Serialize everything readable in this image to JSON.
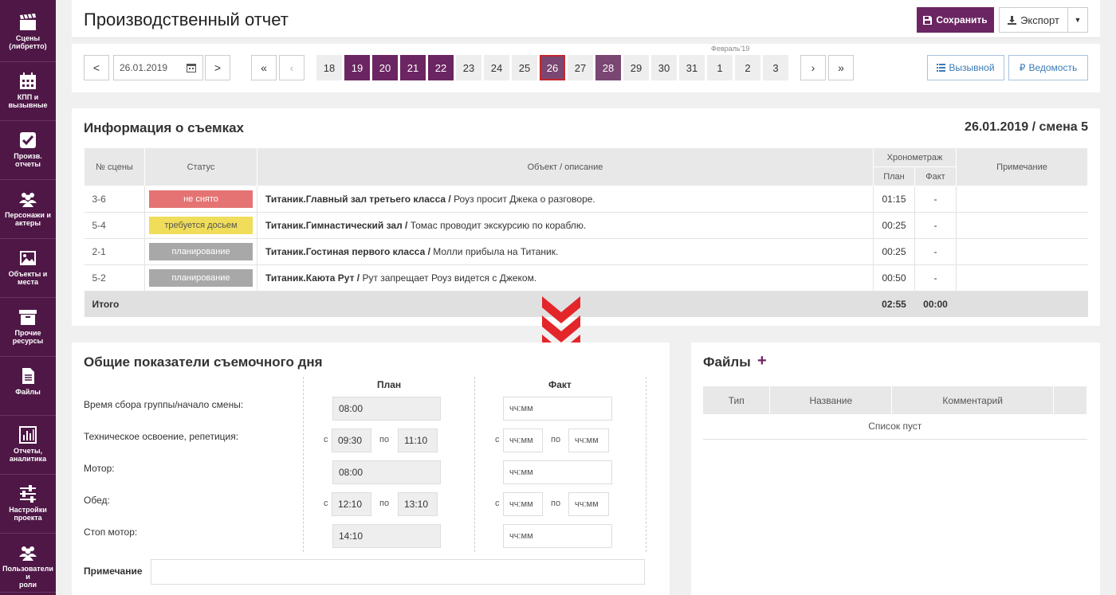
{
  "sidebar": {
    "items": [
      {
        "label": "Сцены\n(либретто)",
        "icon": "clapperboard-icon"
      },
      {
        "label": "КПП и\nвызывные",
        "icon": "calendar-icon"
      },
      {
        "label": "Произв.\nотчеты",
        "icon": "checkbox-icon"
      },
      {
        "label": "Персонажи и\nактеры",
        "icon": "people-icon"
      },
      {
        "label": "Объекты и\nместа",
        "icon": "image-icon"
      },
      {
        "label": "Прочие\nресурсы",
        "icon": "archive-icon"
      },
      {
        "label": "Файлы",
        "icon": "file-icon"
      },
      {
        "label": "Отчеты,\nаналитика",
        "icon": "bar-chart-icon"
      },
      {
        "label": "Настройки\nпроекта",
        "icon": "sliders-icon"
      },
      {
        "label": "Пользователи и\nроли",
        "icon": "users-icon"
      }
    ]
  },
  "header": {
    "title": "Производственный отчет",
    "save_label": "Сохранить",
    "export_label": "Экспорт"
  },
  "datenav": {
    "prev": "<",
    "next": ">",
    "date_value": "26.01.2019",
    "first": "«",
    "prev_page": "‹",
    "next_page": "›",
    "last": "»",
    "month_label": "Февраль'19",
    "days": [
      {
        "label": "18",
        "state": "plain"
      },
      {
        "label": "19",
        "state": "done"
      },
      {
        "label": "20",
        "state": "done"
      },
      {
        "label": "21",
        "state": "done"
      },
      {
        "label": "22",
        "state": "done"
      },
      {
        "label": "23",
        "state": "plain"
      },
      {
        "label": "24",
        "state": "plain"
      },
      {
        "label": "25",
        "state": "plain"
      },
      {
        "label": "26",
        "state": "sel"
      },
      {
        "label": "27",
        "state": "plain"
      },
      {
        "label": "28",
        "state": "light"
      },
      {
        "label": "29",
        "state": "plain"
      },
      {
        "label": "30",
        "state": "plain"
      },
      {
        "label": "31",
        "state": "plain"
      },
      {
        "label": "1",
        "state": "plain"
      },
      {
        "label": "2",
        "state": "plain"
      },
      {
        "label": "3",
        "state": "plain"
      }
    ],
    "callsheet_label": "Вызывной",
    "statement_label": "Ведомость"
  },
  "shooting": {
    "title": "Информация о съемках",
    "date_shift": "26.01.2019 / смена 5",
    "headers": {
      "scene": "№ сцены",
      "status": "Статус",
      "object": "Объект / описание",
      "timing": "Хронометраж",
      "plan": "План",
      "fact": "Факт",
      "note": "Примечание"
    },
    "rows": [
      {
        "scene": "3-6",
        "status": "не снято",
        "status_kind": "red",
        "object": "Титаник.Главный зал третьего класса /",
        "desc": " Роуз просит Джека о разговоре.",
        "plan": "01:15",
        "fact": "-",
        "note": ""
      },
      {
        "scene": "5-4",
        "status": "требуется досьем",
        "status_kind": "yellow",
        "object": "Титаник.Гимнастический зал /",
        "desc": " Томас проводит экскурсию по кораблю.",
        "plan": "00:25",
        "fact": "-",
        "note": ""
      },
      {
        "scene": "2-1",
        "status": "планирование",
        "status_kind": "gray",
        "object": "Титаник.Гостиная первого класса /",
        "desc": " Молли прибыла на Титаник.",
        "plan": "00:25",
        "fact": "-",
        "note": ""
      },
      {
        "scene": "5-2",
        "status": "планирование",
        "status_kind": "gray",
        "object": "Титаник.Каюта Рут /",
        "desc": " Рут запрещает Роуз видется с Джеком.",
        "plan": "00:50",
        "fact": "-",
        "note": ""
      }
    ],
    "total_label": "Итого",
    "total_plan": "02:55",
    "total_fact": "00:00"
  },
  "indicators": {
    "title": "Общие показатели съемочного дня",
    "plan_head": "План",
    "fact_head": "Факт",
    "from": "с",
    "to": "по",
    "placeholder": "чч:мм",
    "rows": [
      {
        "label": "Время сбора группы/начало смены:",
        "plan": "08:00"
      },
      {
        "label": "Техническое освоение, репетиция:",
        "plan_from": "09:30",
        "plan_to": "11:10"
      },
      {
        "label": "Мотор:",
        "plan": "08:00"
      },
      {
        "label": "Обед:",
        "plan_from": "12:10",
        "plan_to": "13:10"
      },
      {
        "label": "Стоп мотор:",
        "plan": "14:10"
      }
    ],
    "note_label": "Примечание",
    "note_value": ""
  },
  "files": {
    "title": "Файлы",
    "add": "+",
    "headers": [
      "Тип",
      "Название",
      "Комментарий"
    ],
    "empty": "Список пуст"
  },
  "colors": {
    "sidebar": "#4e1746",
    "accent": "#6b2562",
    "arrow": "#e3262a"
  }
}
